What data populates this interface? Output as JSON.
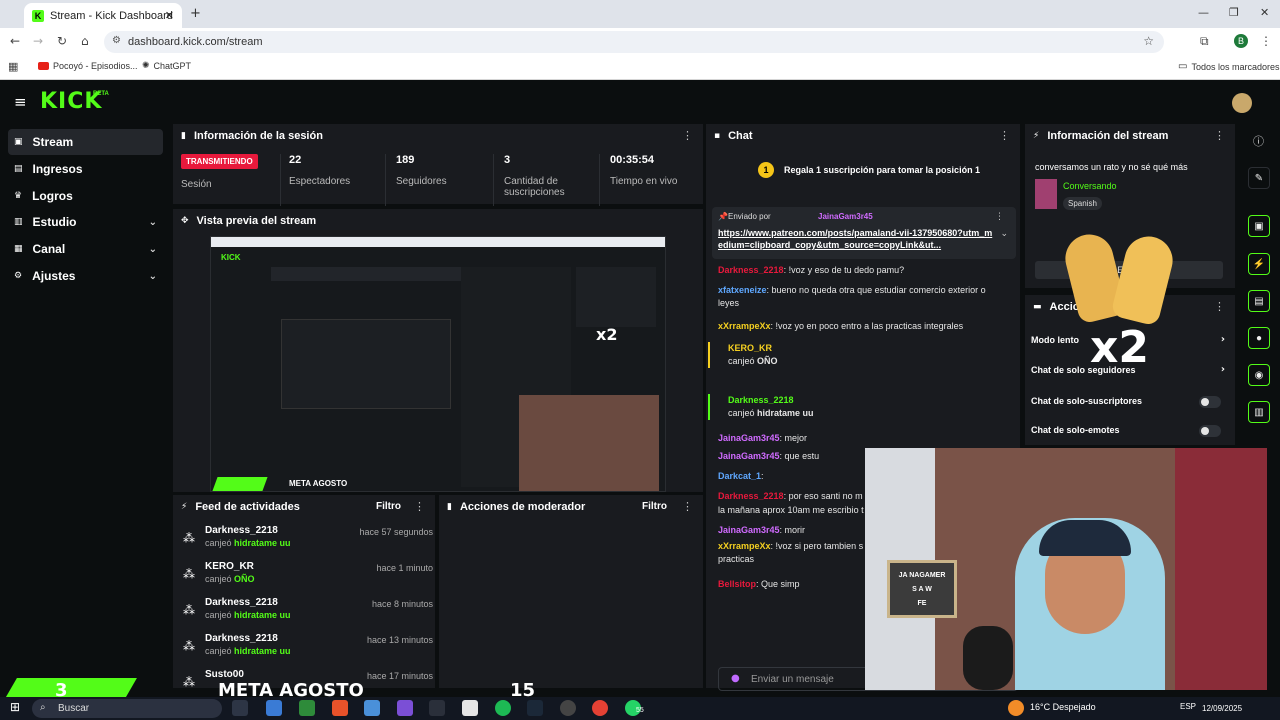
{
  "browser": {
    "tab_title": "Stream - Kick Dashboard",
    "url": "dashboard.kick.com/stream",
    "bookmarks": [
      "Pocoyó - Episodios...",
      "ChatGPT"
    ],
    "bookmarks_right": "Todos los marcadores",
    "profile_letter": "B"
  },
  "brand": {
    "logo": "KICK",
    "beta": "BETA",
    "accent": "#53fc18",
    "live_color": "#e8193c"
  },
  "sidebar": {
    "items": [
      {
        "label": "Stream",
        "icon": "stream-icon",
        "active": true
      },
      {
        "label": "Ingresos",
        "icon": "revenue-icon"
      },
      {
        "label": "Logros",
        "icon": "trophy-icon"
      },
      {
        "label": "Estudio",
        "icon": "studio-icon",
        "expandable": true
      },
      {
        "label": "Canal",
        "icon": "channel-icon",
        "expandable": true
      },
      {
        "label": "Ajustes",
        "icon": "gear-icon",
        "expandable": true
      }
    ]
  },
  "session": {
    "title": "Información de la sesión",
    "live_badge": "TRANSMITIENDO",
    "live_label": "Sesión",
    "stats": [
      {
        "value": "22",
        "label": "Espectadores"
      },
      {
        "value": "189",
        "label": "Seguidores"
      },
      {
        "value": "3",
        "label": "Cantidad de suscripciones"
      },
      {
        "value": "00:35:54",
        "label": "Tiempo en vivo"
      }
    ]
  },
  "preview": {
    "title": "Vista previa del stream"
  },
  "activity": {
    "title": "Feed de actividades",
    "filter": "Filtro",
    "rows": [
      {
        "user": "Darkness_2218",
        "action": "canjeó",
        "reward": "hidratame uu",
        "time": "hace 57 segundos"
      },
      {
        "user": "KERO_KR",
        "action": "canjeó",
        "reward": "OÑO",
        "time": "hace 1 minuto"
      },
      {
        "user": "Darkness_2218",
        "action": "canjeó",
        "reward": "hidratame uu",
        "time": "hace 8 minutos"
      },
      {
        "user": "Darkness_2218",
        "action": "canjeó",
        "reward": "hidratame uu",
        "time": "hace 13 minutos"
      },
      {
        "user": "Susto00",
        "action": "",
        "reward": "",
        "time": "hace 17 minutos"
      }
    ]
  },
  "modactions": {
    "title": "Acciones de moderador",
    "filter": "Filtro"
  },
  "chat": {
    "title": "Chat",
    "gift_badge": "1",
    "gift_prompt": "Regala 1 suscripción para tomar la posición 1",
    "pinned_by_label": "Enviado por",
    "pinned_user": "JainaGam3r45",
    "pinned_link": "https://www.patreon.com/posts/pamaland-vii-137950680?utm_medium=clipboard_copy&utm_source=copyLink&ut...",
    "messages": [
      {
        "user": "Darkness_2218",
        "text": ": !voz y eso de tu dedo pamu?",
        "color": "#e8193c"
      },
      {
        "user": "xfatxeneize",
        "text": ": bueno no queda otra que estudiar comercio exterior o leyes",
        "color": "#5fa8ff"
      },
      {
        "user": "xXrrampeXx",
        "text": ": !voz yo en poco entro a las practicas integrales",
        "color": "#f5d020"
      },
      {
        "user": "KERO_KR",
        "text": "canjeó",
        "reward": "OÑO",
        "color": "#f5d020",
        "redeem": true
      },
      {
        "user": "Darkness_2218",
        "text": "canjeó",
        "reward": "hidratame uu",
        "color": "#53fc18",
        "redeem": true
      },
      {
        "user": "JainaGam3r45",
        "text": ": mejor",
        "color": "#d06bff"
      },
      {
        "user": "JainaGam3r45",
        "text": ": que estu",
        "color": "#d06bff"
      },
      {
        "user": "Darkcat_1",
        "text": ":",
        "color": "#5fa8ff"
      },
      {
        "user": "Darkness_2218",
        "text": ": por eso santi no m",
        "color": "#e8193c"
      },
      {
        "user": "",
        "text": "la mañana aprox 10am me escribio t",
        "color": "#e6e6e6"
      },
      {
        "user": "JainaGam3r45",
        "text": ": morir",
        "color": "#d06bff"
      },
      {
        "user": "xXrrampeXx",
        "text": ": !voz si pero tambien s practicas",
        "color": "#f5d020"
      },
      {
        "user": "Bellsitop",
        "text": ": Que simp",
        "color": "#e8193c"
      }
    ],
    "input_placeholder": "Enviar un mensaje",
    "points": "∞"
  },
  "stream_info": {
    "title": "Información del stream",
    "stream_title": "conversamos un rato y no sé qué más",
    "category": "Conversando",
    "language": "Spanish",
    "edit_button": "Editar"
  },
  "quick_actions": {
    "title": "Acciones rápidas",
    "items": [
      {
        "label": "Modo lento",
        "type": "chevron"
      },
      {
        "label": "Chat de solo seguidores",
        "type": "chevron"
      },
      {
        "label": "Chat de solo-suscriptores",
        "type": "toggle"
      },
      {
        "label": "Chat de solo-emotes",
        "type": "toggle"
      }
    ]
  },
  "overlay": {
    "multiplier": "x2",
    "meta_count": "3",
    "meta_label": "META AGOSTO",
    "meta_goal": "15",
    "sign_text": [
      "JA NAGAMER",
      "S A W",
      "FE"
    ]
  },
  "taskbar": {
    "search": "Buscar",
    "weather": "16°C Despejado",
    "lang": "ESP",
    "date": "12/09/2025",
    "whatsapp_badge": "55"
  }
}
